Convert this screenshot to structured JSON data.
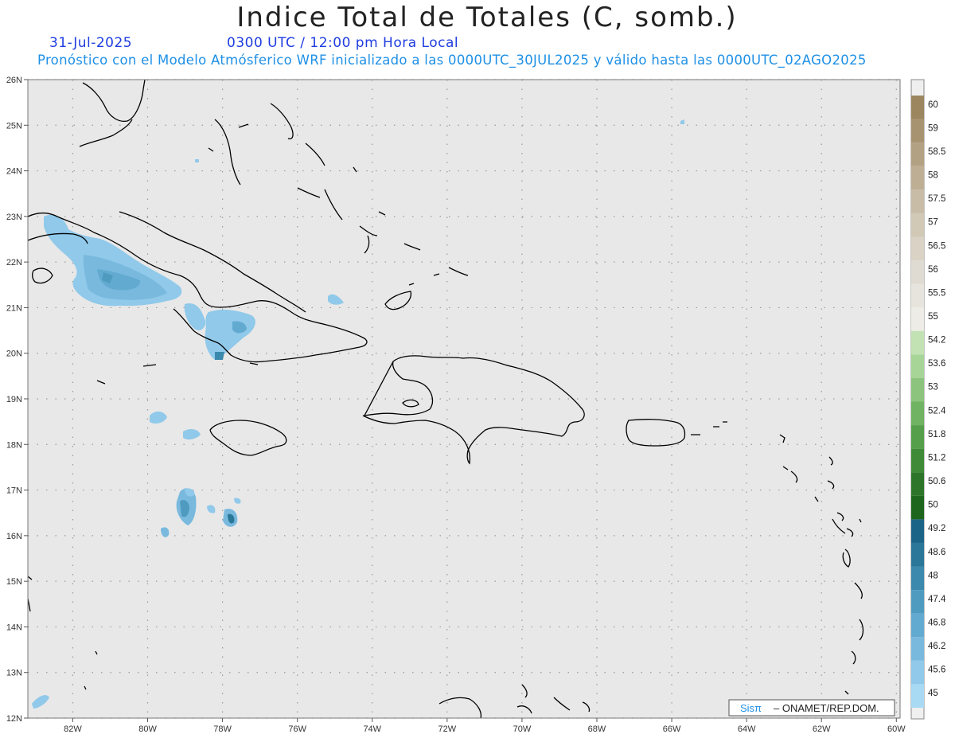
{
  "header": {
    "title": "Indice Total de Totales (C, somb.)",
    "date": "31-Jul-2025",
    "time": "0300 UTC / 12:00 pm Hora Local",
    "description": "Pronóstico con el Modelo Atmósferico WRF inicializado a las 0000UTC_30JUL2025 y válido hasta las  0000UTC_02AGO2025"
  },
  "map": {
    "lat_ticks": [
      "26N",
      "25N",
      "24N",
      "23N",
      "22N",
      "21N",
      "20N",
      "19N",
      "18N",
      "17N",
      "16N",
      "15N",
      "14N",
      "13N",
      "12N"
    ],
    "lon_ticks": [
      "82W",
      "80W",
      "78W",
      "76W",
      "74W",
      "72W",
      "70W",
      "68W",
      "66W",
      "64W",
      "62W",
      "60W"
    ],
    "lat_range": [
      12,
      26
    ],
    "lon_range": [
      -83.2,
      -59.9
    ],
    "background_color": "#e8e8e8",
    "grid": "dotted"
  },
  "legend": {
    "levels": [
      "60",
      "59",
      "58.5",
      "58",
      "57.5",
      "57",
      "56.5",
      "56",
      "55.5",
      "55",
      "54.2",
      "53.6",
      "53",
      "52.4",
      "51.8",
      "51.2",
      "50.6",
      "50",
      "49.2",
      "48.6",
      "48",
      "47.4",
      "46.8",
      "46.2",
      "45.6",
      "45"
    ],
    "colors": [
      "#9c8660",
      "#a89371",
      "#b3a183",
      "#beae94",
      "#c8bca6",
      "#d1c8b6",
      "#d9d2c5",
      "#e0dbd2",
      "#e7e4de",
      "#eeece6",
      "#c2e2b4",
      "#a7d497",
      "#8cc47d",
      "#70b363",
      "#559f4b",
      "#3f8a37",
      "#2d7629",
      "#1e661d",
      "#1c6487",
      "#2a7799",
      "#3b89ad",
      "#4f9bc0",
      "#63aad1",
      "#79b9de",
      "#90c9ea",
      "#a8daf4"
    ]
  },
  "credit": {
    "brand": "Sisπ",
    "org": "– ONAMET/REP.DOM."
  }
}
